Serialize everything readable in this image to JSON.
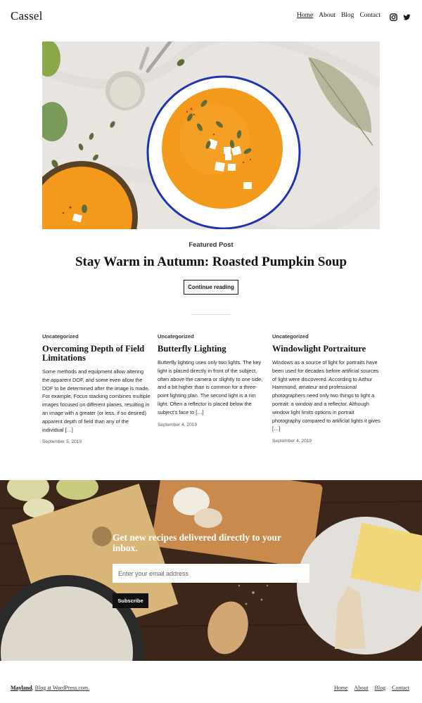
{
  "header": {
    "site_title": "Cassel",
    "nav": [
      "Home",
      "About",
      "Blog",
      "Contact"
    ],
    "social_icons": [
      "instagram-icon",
      "twitter-icon"
    ]
  },
  "featured": {
    "label": "Featured Post",
    "title": "Stay Warm in Autumn: Roasted Pumpkin Soup",
    "button": "Continue reading"
  },
  "posts": [
    {
      "category": "Uncategorized",
      "title": "Overcoming Depth of Field Limitations",
      "excerpt": "Some methods and equipment allow altering the apparent DOF, and some even allow the DOF to be determined after the image is made. For example, Focus stacking combines multiple images focused on different planes, resulting in an image with a greater (or less, if so desired) apparent depth of field than any of the individual […]",
      "date": "September 5, 2019"
    },
    {
      "category": "Uncategorized",
      "title": "Butterfly Lighting",
      "excerpt": "Butterfly lighting uses only two lights. The key light is placed directly in front of the subject, often above the camera or slightly to one side, and a bit higher than is common for a three-point lighting plan. The second light is a rim light. Often a reflector is placed below the subject’s face to […]",
      "date": "September 4, 2019"
    },
    {
      "category": "Uncategorized",
      "title": "Windowlight Portraiture",
      "excerpt": "Windows as a source of light for portraits have been used for decades before artificial sources of light were discovered. According to Arthur Hammond, amateur and professional photographers need only two things to light a portrait: a window and a reflector. Although window light limits options in portrait photography compared to artificial lights it gives […]",
      "date": "September 4, 2019"
    }
  ],
  "newsletter": {
    "heading": "Get new recipes delivered directly to your inbox.",
    "placeholder": "Enter your email address",
    "button": "Subscribe"
  },
  "footer": {
    "site_name": "Mayland",
    "credit": "Blog at WordPress.com.",
    "nav": [
      "Home",
      "About",
      "Blog",
      "Contact"
    ]
  },
  "colors": {
    "soup": "#f39a1c",
    "bowl_rim": "#1f34b0",
    "wood": "#3a2418"
  }
}
